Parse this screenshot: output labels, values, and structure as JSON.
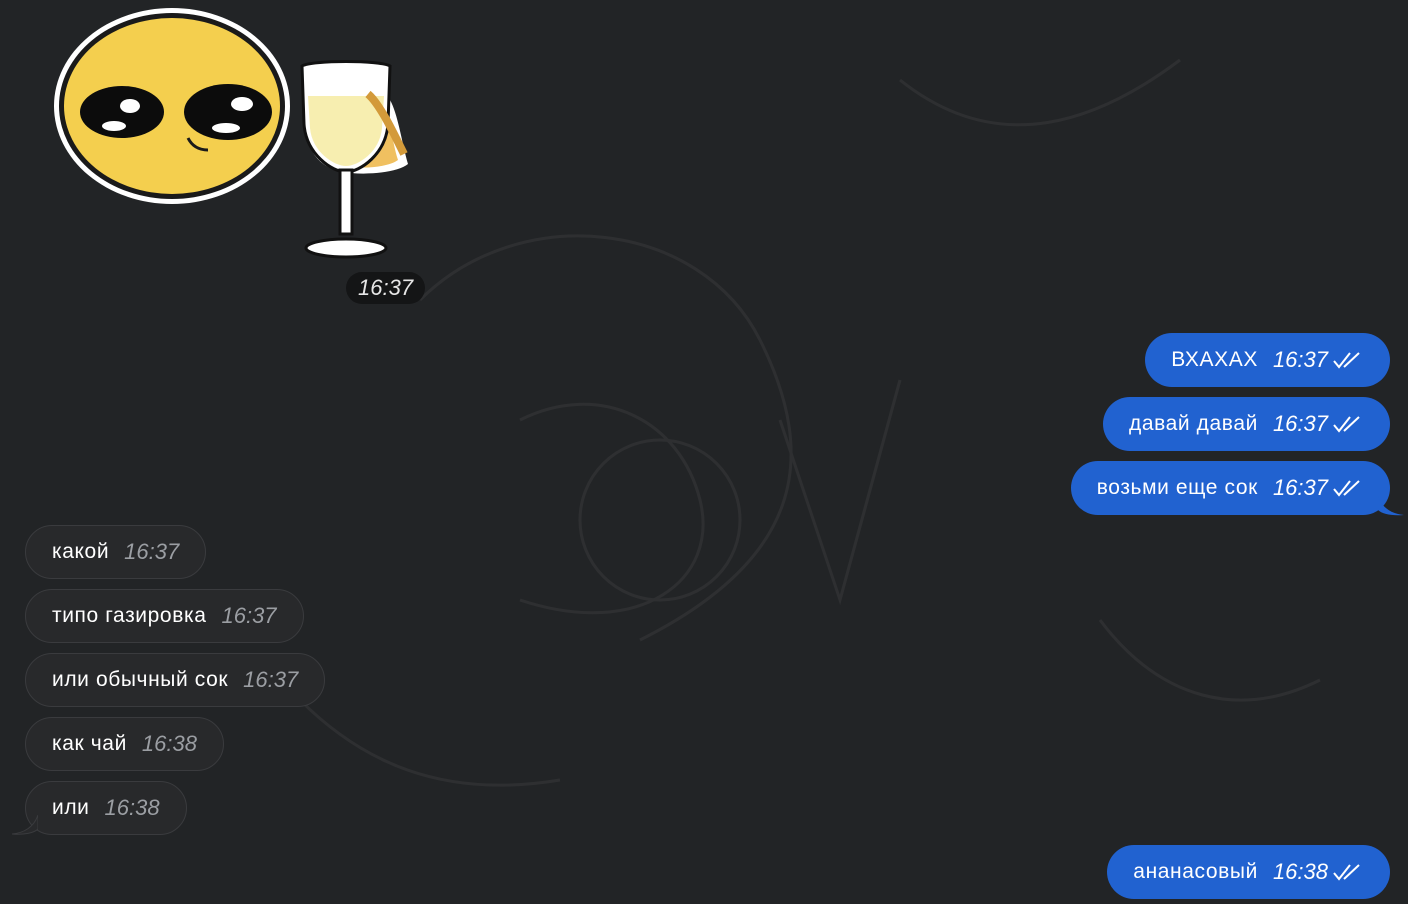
{
  "colors": {
    "background": "#222426",
    "incoming_bubble": "#28292b",
    "outgoing_bubble": "#2162d0",
    "incoming_time": "#9b9ea3"
  },
  "sticker": {
    "icon": "smiley-wine-glass-sticker",
    "time": "16:37"
  },
  "outgoing_group_1": [
    {
      "text": "ВХАХАХ",
      "time": "16:37",
      "status_icon": "double-check-icon"
    },
    {
      "text": "давай давай",
      "time": "16:37",
      "status_icon": "double-check-icon"
    },
    {
      "text": "возьми еще сок",
      "time": "16:37",
      "status_icon": "double-check-icon"
    }
  ],
  "incoming_group": [
    {
      "text": "какой",
      "time": "16:37"
    },
    {
      "text": "типо газировка",
      "time": "16:37"
    },
    {
      "text": "или обычный сок",
      "time": "16:37"
    },
    {
      "text": "как чай",
      "time": "16:38"
    },
    {
      "text": "или",
      "time": "16:38"
    }
  ],
  "outgoing_group_2": [
    {
      "text": "ананасовый",
      "time": "16:38",
      "status_icon": "double-check-icon"
    }
  ]
}
